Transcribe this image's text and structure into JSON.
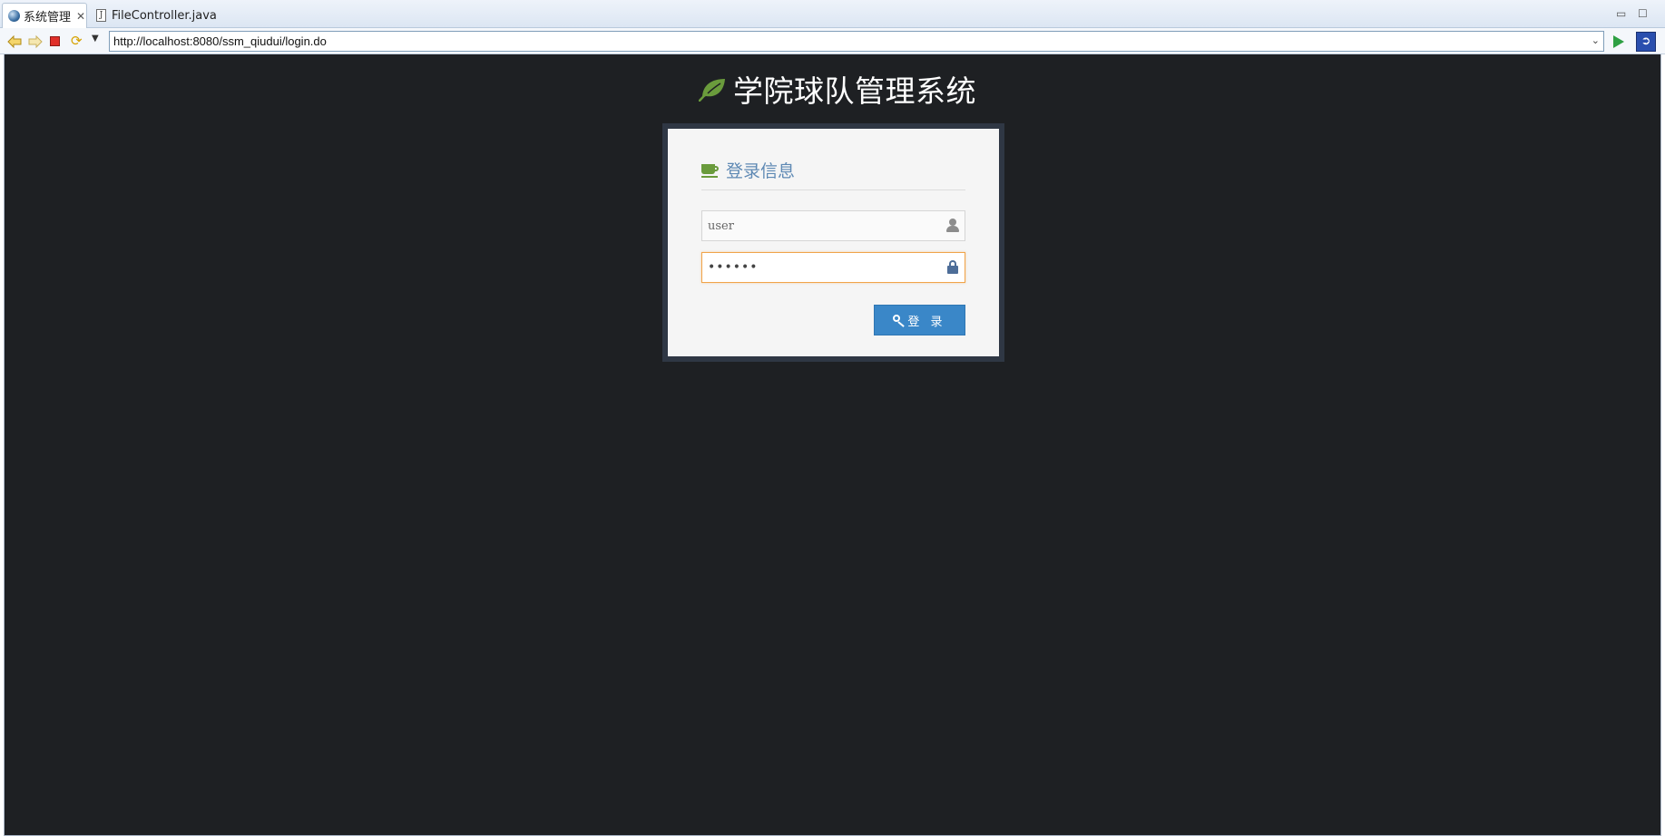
{
  "browser": {
    "tabs": [
      {
        "label": "系统管理",
        "active": true
      },
      {
        "label": "FileController.java",
        "active": false
      }
    ],
    "url": "http://localhost:8080/ssm_qiudui/login.do"
  },
  "page": {
    "brand_title": "学院球队管理系统",
    "background_color": "#1e2023",
    "login": {
      "header": "登录信息",
      "username_value": "user",
      "password_mask": "••••••",
      "submit_label": "登 录"
    }
  },
  "colors": {
    "accent_green": "#6a9b3c",
    "header_text": "#5e89b4",
    "button_blue": "#3a87c8",
    "focus_orange": "#f0a44a"
  },
  "icons": {
    "brand": "leaf-icon",
    "header": "coffee-icon",
    "username": "user-icon",
    "password": "lock-icon",
    "submit": "key-icon"
  }
}
